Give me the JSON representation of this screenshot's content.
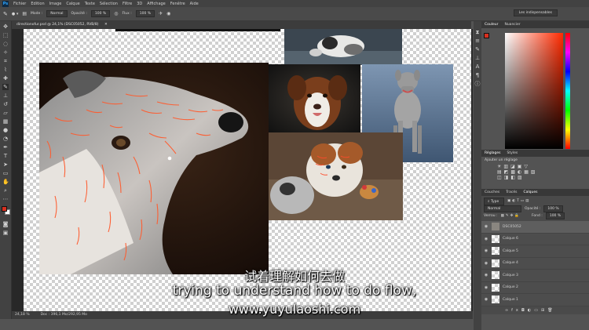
{
  "menu": {
    "logo": "Ps",
    "items": [
      "Fichier",
      "Edition",
      "Image",
      "Calque",
      "Texte",
      "Sélection",
      "Filtre",
      "3D",
      "Affichage",
      "Fenêtre",
      "Aide"
    ]
  },
  "options": {
    "mode_label": "Mode :",
    "mode_value": "Normal",
    "opacity_label": "Opacité :",
    "opacity_value": "100 %",
    "flow_label": "Flux :",
    "flow_value": "100 %",
    "workspace": "Les indispensables"
  },
  "document": {
    "tab_title": "directionofur.psd @ 24,1% (DSC05052, RVB/8)",
    "zoom": "24,18 %",
    "doc_info": "Doc : 396,1 Mo/292,95 Mo"
  },
  "color_panel": {
    "tabs": [
      "Couleur",
      "Nuancier"
    ]
  },
  "adjust_panel": {
    "tabs": [
      "Réglages",
      "Styles"
    ],
    "subtitle": "Ajouter un réglage"
  },
  "layers_panel": {
    "tabs": [
      "Couches",
      "Tracés",
      "Calques"
    ],
    "filter": "Type",
    "blend_mode": "Normal",
    "opacity_label": "Opacité :",
    "opacity_value": "100 %",
    "lock_label": "Verrou :",
    "fill_label": "Fond :",
    "fill_value": "100 %",
    "layers": [
      "DSC05052",
      "Calque 6",
      "Calque 5",
      "Calque 4",
      "Calque 3",
      "Calque 2",
      "Calque 1"
    ]
  },
  "subtitles": {
    "chinese": "试着理解如何去做",
    "english": "trying to understand how to do flow,",
    "site": "www.yuyulaoshi.com"
  },
  "colors": {
    "foreground": "#d7301f",
    "background": "#ffffff"
  }
}
